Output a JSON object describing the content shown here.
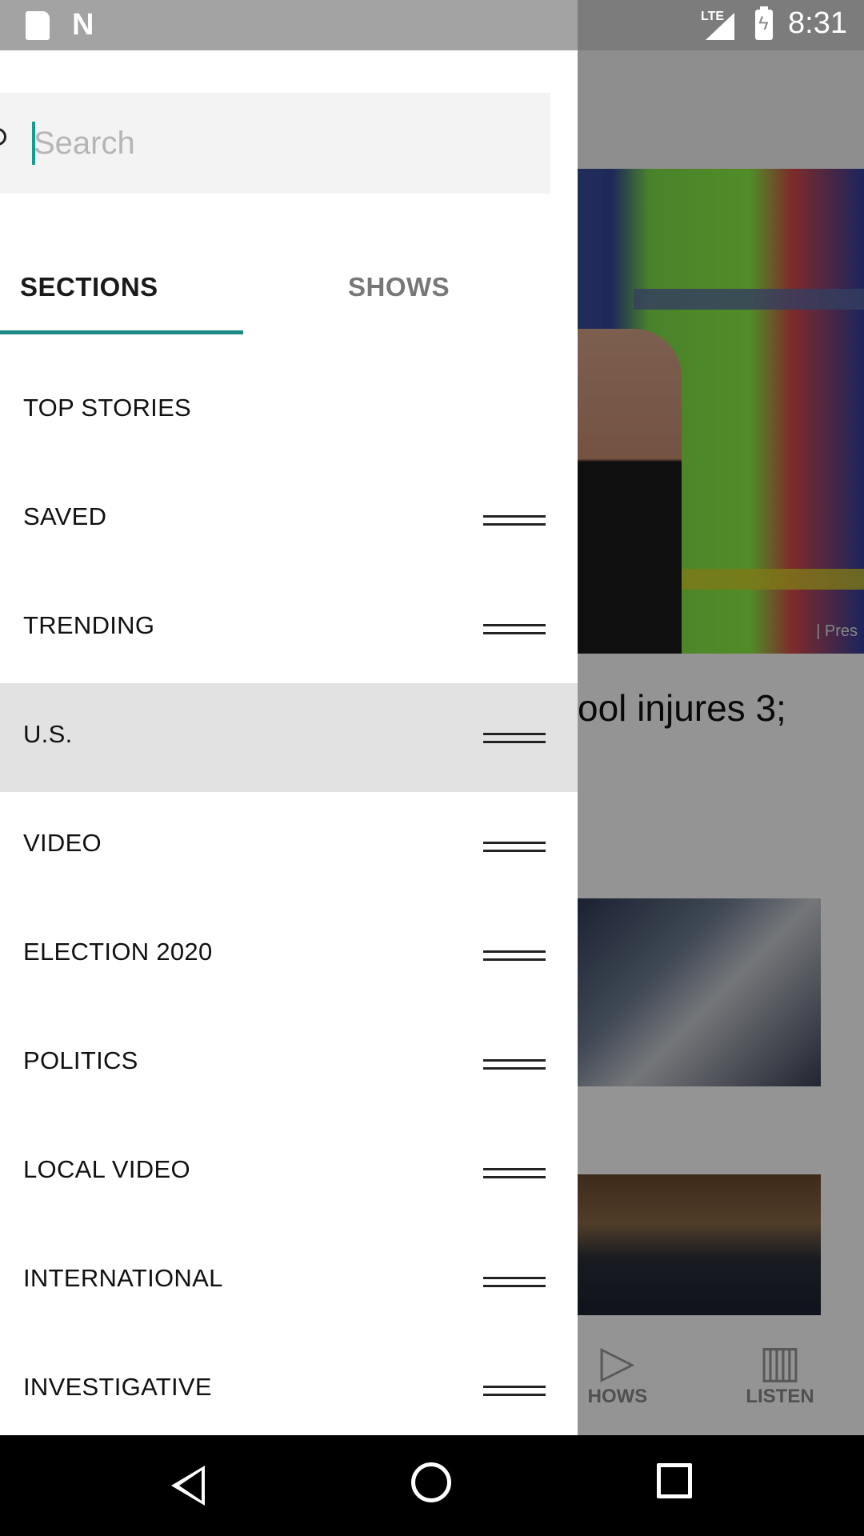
{
  "status_bar": {
    "network": "LTE",
    "time": "8:31"
  },
  "search": {
    "placeholder": "Search",
    "value": ""
  },
  "tabs": [
    {
      "label": "SECTIONS",
      "selected": true
    },
    {
      "label": "SHOWS",
      "selected": false
    }
  ],
  "sections": [
    {
      "label": "TOP STORIES",
      "reorderable": false
    },
    {
      "label": "SAVED",
      "reorderable": true
    },
    {
      "label": "TRENDING",
      "reorderable": true
    },
    {
      "label": "U.S.",
      "reorderable": true,
      "highlighted": true
    },
    {
      "label": "VIDEO",
      "reorderable": true
    },
    {
      "label": "ELECTION 2020",
      "reorderable": true
    },
    {
      "label": "POLITICS",
      "reorderable": true
    },
    {
      "label": "LOCAL VIDEO",
      "reorderable": true
    },
    {
      "label": "INTERNATIONAL",
      "reorderable": true
    },
    {
      "label": "INVESTIGATIVE",
      "reorderable": true
    }
  ],
  "background": {
    "photo_credit": "| Pres",
    "headline": "ool injures 3;",
    "nav": [
      {
        "label": "HOWS",
        "icon": "play-circle-icon"
      },
      {
        "label": "LISTEN",
        "icon": "equalizer-icon"
      }
    ]
  },
  "colors": {
    "accent": "#1b8a85",
    "caret": "#179b8e",
    "highlight_row": "#e2e2e2"
  }
}
